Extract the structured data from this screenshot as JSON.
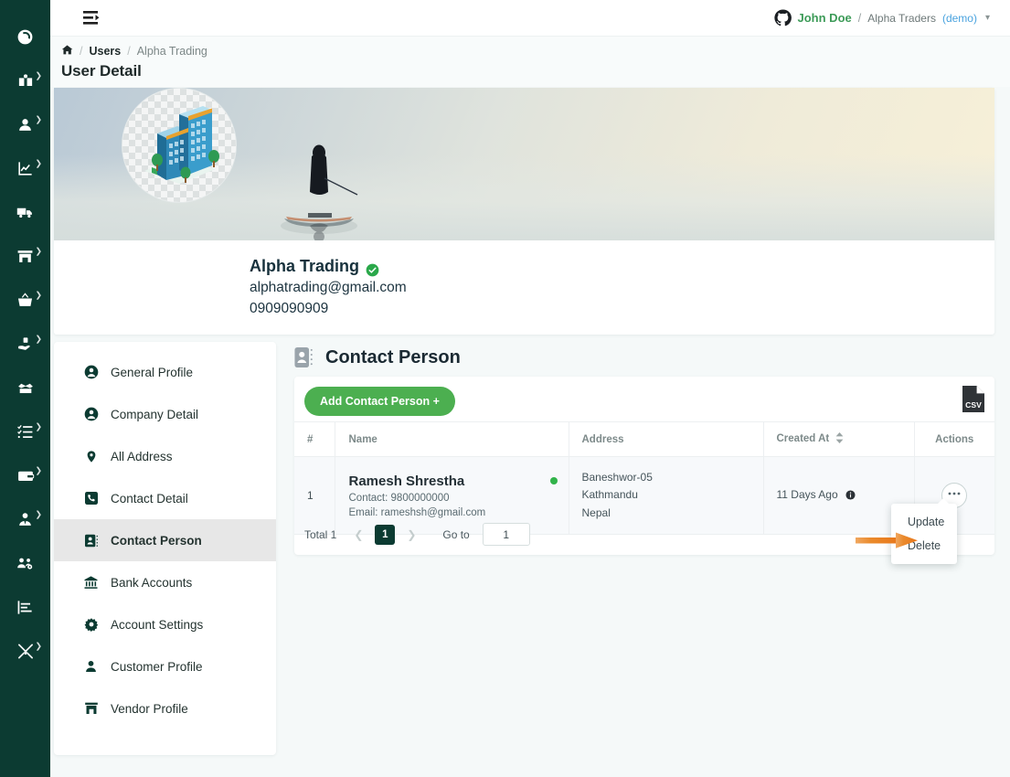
{
  "rail": {
    "items": [
      {
        "name": "dashboard",
        "icon": "dashboard-icon",
        "has_caret": false
      },
      {
        "name": "catalog",
        "icon": "book-user-icon",
        "has_caret": true
      },
      {
        "name": "users",
        "icon": "user-icon",
        "has_caret": true
      },
      {
        "name": "reports",
        "icon": "chart-line-icon",
        "has_caret": true
      },
      {
        "name": "delivery",
        "icon": "truck-icon",
        "has_caret": false
      },
      {
        "name": "store",
        "icon": "store-icon",
        "has_caret": true
      },
      {
        "name": "purchase",
        "icon": "basket-icon",
        "has_caret": true
      },
      {
        "name": "payments",
        "icon": "hand-money-icon",
        "has_caret": true
      },
      {
        "name": "inventory",
        "icon": "box-open-icon",
        "has_caret": false
      },
      {
        "name": "tasks",
        "icon": "checklist-icon",
        "has_caret": true
      },
      {
        "name": "wallet",
        "icon": "wallet-icon",
        "has_caret": true
      },
      {
        "name": "employees",
        "icon": "user-tie-icon",
        "has_caret": true
      },
      {
        "name": "teams",
        "icon": "users-gear-icon",
        "has_caret": false
      },
      {
        "name": "statements",
        "icon": "bar-report-icon",
        "has_caret": false
      },
      {
        "name": "tools",
        "icon": "tools-icon",
        "has_caret": true
      }
    ]
  },
  "topbar": {
    "menu_fold_icon": "menu-fold-icon",
    "github_icon": "github-icon",
    "user_name": "John Doe",
    "separator": "/",
    "org_name": "Alpha Traders",
    "org_mode": "(demo)",
    "caret": "⌄"
  },
  "breadcrumb": {
    "home_icon": "home-icon",
    "sep": "/",
    "items": [
      {
        "label": "Users",
        "current": false
      },
      {
        "label": "Alpha Trading",
        "current": true
      }
    ]
  },
  "page": {
    "title": "User Detail"
  },
  "profile": {
    "avatar_icon": "office-building-illustration",
    "banner_icon": "fisherman-on-boat-photo",
    "name": "Alpha Trading",
    "verified_icon": "verified-check-icon",
    "email": "alphatrading@gmail.com",
    "phone": "0909090909"
  },
  "tabs": {
    "items": [
      {
        "label": "General Profile",
        "icon": "user-circle-icon",
        "active": false
      },
      {
        "label": "Company Detail",
        "icon": "user-circle-icon",
        "active": false
      },
      {
        "label": "All Address",
        "icon": "map-pin-icon",
        "active": false
      },
      {
        "label": "Contact Detail",
        "icon": "phone-square-icon",
        "active": false
      },
      {
        "label": "Contact Person",
        "icon": "contact-card-icon",
        "active": true
      },
      {
        "label": "Bank Accounts",
        "icon": "bank-icon",
        "active": false
      },
      {
        "label": "Account Settings",
        "icon": "gear-icon",
        "active": false
      },
      {
        "label": "Customer Profile",
        "icon": "user-solid-icon",
        "active": false
      },
      {
        "label": "Vendor Profile",
        "icon": "store-icon",
        "active": false
      }
    ]
  },
  "panel": {
    "icon": "contact-card-icon",
    "title": "Contact Person",
    "add_button_label": "Add Contact Person +",
    "csv_button_label": "CSV",
    "csv_icon": "csv-file-icon"
  },
  "table": {
    "columns": [
      "#",
      "Name",
      "Address",
      "Created At",
      "Actions"
    ],
    "sort_icon": "sort-updown-icon",
    "rows": [
      {
        "index": "1",
        "name": "Ramesh Shrestha",
        "status_dot": "#31b34a",
        "contact": "Contact: 9800000000",
        "email": "Email: rameshsh@gmail.com",
        "address_line1": "Baneshwor-05",
        "address_line2": "Kathmandu",
        "address_line3": "Nepal",
        "created_at": "11 Days Ago",
        "info_icon": "info-circle-icon",
        "actions_icon": "ellipsis-icon"
      }
    ]
  },
  "action_menu": {
    "items": [
      {
        "label": "Update"
      },
      {
        "label": "Delete"
      }
    ]
  },
  "annotation": {
    "arrow_icon": "orange-right-arrow",
    "arrow_color": "#e8761a"
  },
  "pagination": {
    "total_label": "Total 1",
    "prev_icon": "chevron-left-icon",
    "next_icon": "chevron-right-icon",
    "current_page": "1",
    "goto_label": "Go to",
    "goto_value": "1"
  },
  "colors": {
    "rail_bg": "#0c3b32",
    "accent_green": "#4caf50",
    "page_bg": "#f5f9f9",
    "link_blue": "#4aa3df",
    "status_green": "#31b34a",
    "annotation_orange": "#e8761a"
  }
}
